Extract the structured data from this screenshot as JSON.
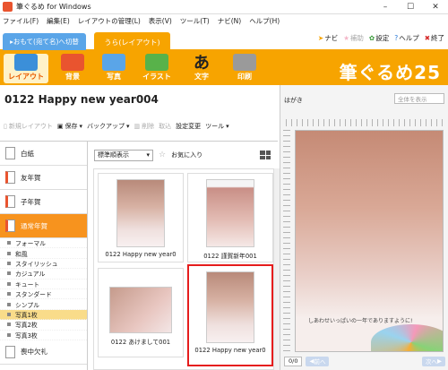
{
  "window": {
    "title": "筆ぐるめ for Windows",
    "min": "–",
    "max": "☐",
    "close": "✕"
  },
  "menu": [
    "ファイル(F)",
    "編集(E)",
    "レイアウトの管理(L)",
    "表示(V)",
    "ツール(T)",
    "ナビ(N)",
    "ヘルプ(H)"
  ],
  "tabs": {
    "omote": "おもて(宛て名)へ切替",
    "ura": "うら(レイアウト)"
  },
  "toplinks": {
    "navi": "ナビ",
    "hojo": "補助",
    "settei": "設定",
    "help": "ヘルプ",
    "exit": "終了"
  },
  "ribbon": {
    "items": [
      "レイアウト",
      "背景",
      "写真",
      "イラスト",
      "文字",
      "印刷"
    ],
    "brand": "筆ぐるめ25",
    "colors": {
      "layout": "#3b8fd9",
      "haikei": "#e9542f",
      "shashin": "#5aa5e8",
      "illust": "#58b24a",
      "moji": "#222222",
      "insatsu": "#9a9a9a"
    }
  },
  "doc_title": "0122  Happy new year004",
  "toolbar": {
    "new_layout": "新規レイアウト",
    "save": "保存",
    "backup": "バックアップ",
    "delete": "削除",
    "import": "取込",
    "settings_change": "設定変更",
    "tools": "ツール"
  },
  "sidebar": {
    "categories": [
      {
        "label": "白紙"
      },
      {
        "label": "友年賀"
      },
      {
        "label": "子年賀"
      },
      {
        "label": "通常年賀"
      }
    ],
    "subitems": [
      "フォーマル",
      "和風",
      "スタイリッシュ",
      "カジュアル",
      "キュート",
      "スタンダード",
      "シンプル",
      "写真1枚",
      "写真2枚",
      "写真3枚"
    ],
    "last_category": "喪中欠礼"
  },
  "content": {
    "sort_label": "標準順表示",
    "favorites": "お気に入り"
  },
  "thumbs": [
    {
      "caption": "0122  Happy new year0"
    },
    {
      "caption": "0122  謹賀新年001"
    },
    {
      "caption": "0122  あけまして001"
    },
    {
      "caption": "0122  Happy new year0"
    }
  ],
  "preview": {
    "type": "はがき",
    "zoom": "全体を表示",
    "message": "しあわせいっぱいの一年でありますように!",
    "page": "0/0",
    "prev": "前へ",
    "next": "次へ"
  }
}
